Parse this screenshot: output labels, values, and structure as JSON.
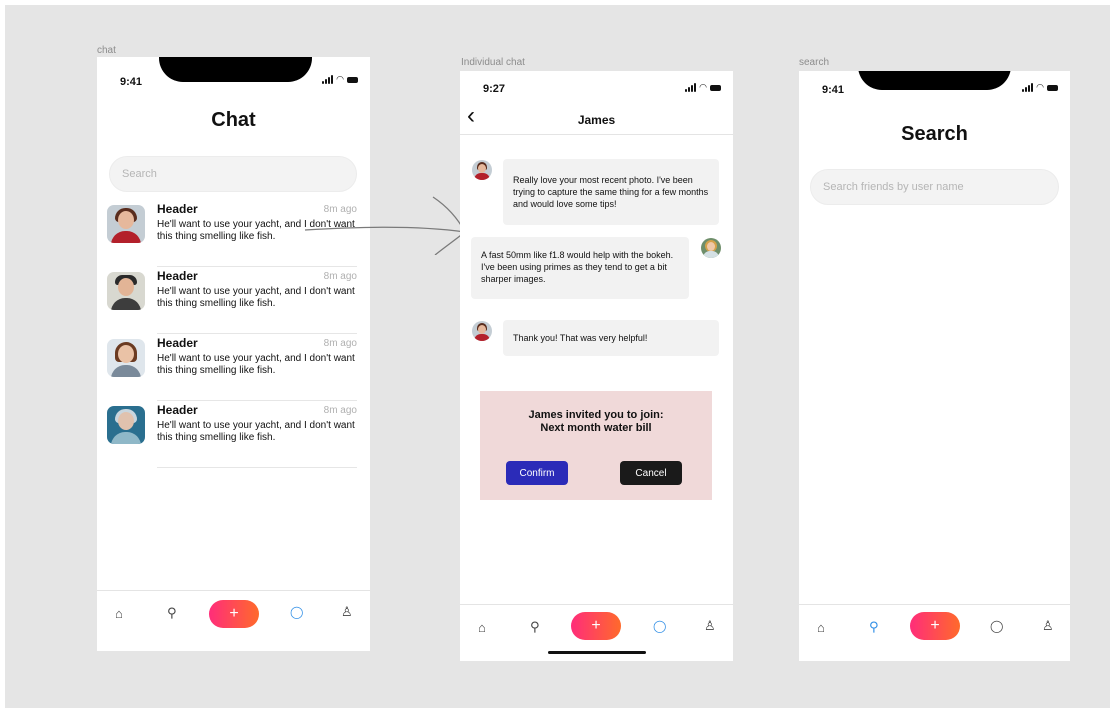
{
  "frames": {
    "chat": "chat",
    "individual": "Individual chat",
    "search": "search"
  },
  "chat_screen": {
    "time": "9:41",
    "title": "Chat",
    "search_placeholder": "Search",
    "rows": [
      {
        "header": "Header",
        "time": "8m ago",
        "text": "He'll want to use your yacht, and I don't want this thing smelling like fish."
      },
      {
        "header": "Header",
        "time": "8m ago",
        "text": "He'll want to use your yacht, and I don't want this thing smelling like fish."
      },
      {
        "header": "Header",
        "time": "8m ago",
        "text": "He'll want to use your yacht, and I don't want this thing smelling like fish."
      },
      {
        "header": "Header",
        "time": "8m ago",
        "text": "He'll want to use your yacht, and I don't want this thing smelling like fish."
      }
    ]
  },
  "individual_screen": {
    "time": "9:27",
    "title": "James",
    "back_glyph": "‹",
    "messages": [
      {
        "text": "Really love your most recent photo. I've been trying to capture the same thing for a few months and would love some tips!"
      },
      {
        "text": "A fast 50mm like f1.8 would help with the bokeh. I've been using primes as they tend to get a bit sharper images."
      },
      {
        "text": "Thank you! That was very helpful!"
      }
    ],
    "invite": {
      "line1": "James invited you to join:",
      "line2": "Next month water bill",
      "confirm": "Confirm",
      "cancel": "Cancel",
      "confirm_color": "#2b2bb8",
      "cancel_color": "#1a1a1a"
    }
  },
  "search_screen": {
    "time": "9:41",
    "title": "Search",
    "search_placeholder": "Search friends by user name"
  },
  "tab_bar": {
    "home": "⌂",
    "search": "⚲",
    "plus": "+",
    "chat": "◯",
    "profile": "♙"
  },
  "colors": {
    "accent_blue": "#2f8ee6",
    "plus_gradient_start": "#ff2d7a",
    "plus_gradient_end": "#ff6a2b",
    "invite_bg": "#f0d9d9"
  }
}
